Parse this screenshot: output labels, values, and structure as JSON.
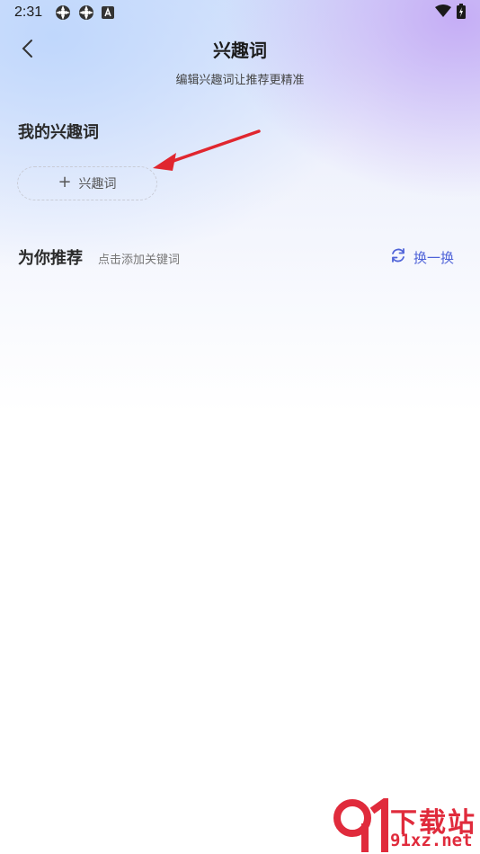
{
  "status_bar": {
    "time": "2:31",
    "left_icons": [
      "settings-flower-icon",
      "settings-flower-icon",
      "notification-a-icon"
    ],
    "right_icons": [
      "wifi-icon",
      "battery-charging-icon"
    ]
  },
  "header": {
    "back_icon": "chevron-left-icon",
    "title": "兴趣词",
    "subtitle": "编辑兴趣词让推荐更精准"
  },
  "my_interests": {
    "title": "我的兴趣词",
    "add_button_icon": "plus-icon",
    "add_button_label": "兴趣词"
  },
  "recommend": {
    "title": "为你推荐",
    "hint": "点击添加关键词",
    "refresh_icon": "refresh-icon",
    "refresh_label": "换一换"
  },
  "watermark": {
    "text_line1": "下载站",
    "text_line2": "91xz.net"
  },
  "colors": {
    "accent": "#4f63d8",
    "arrow_annotation": "#e0262f",
    "watermark": "#e02b3c"
  }
}
